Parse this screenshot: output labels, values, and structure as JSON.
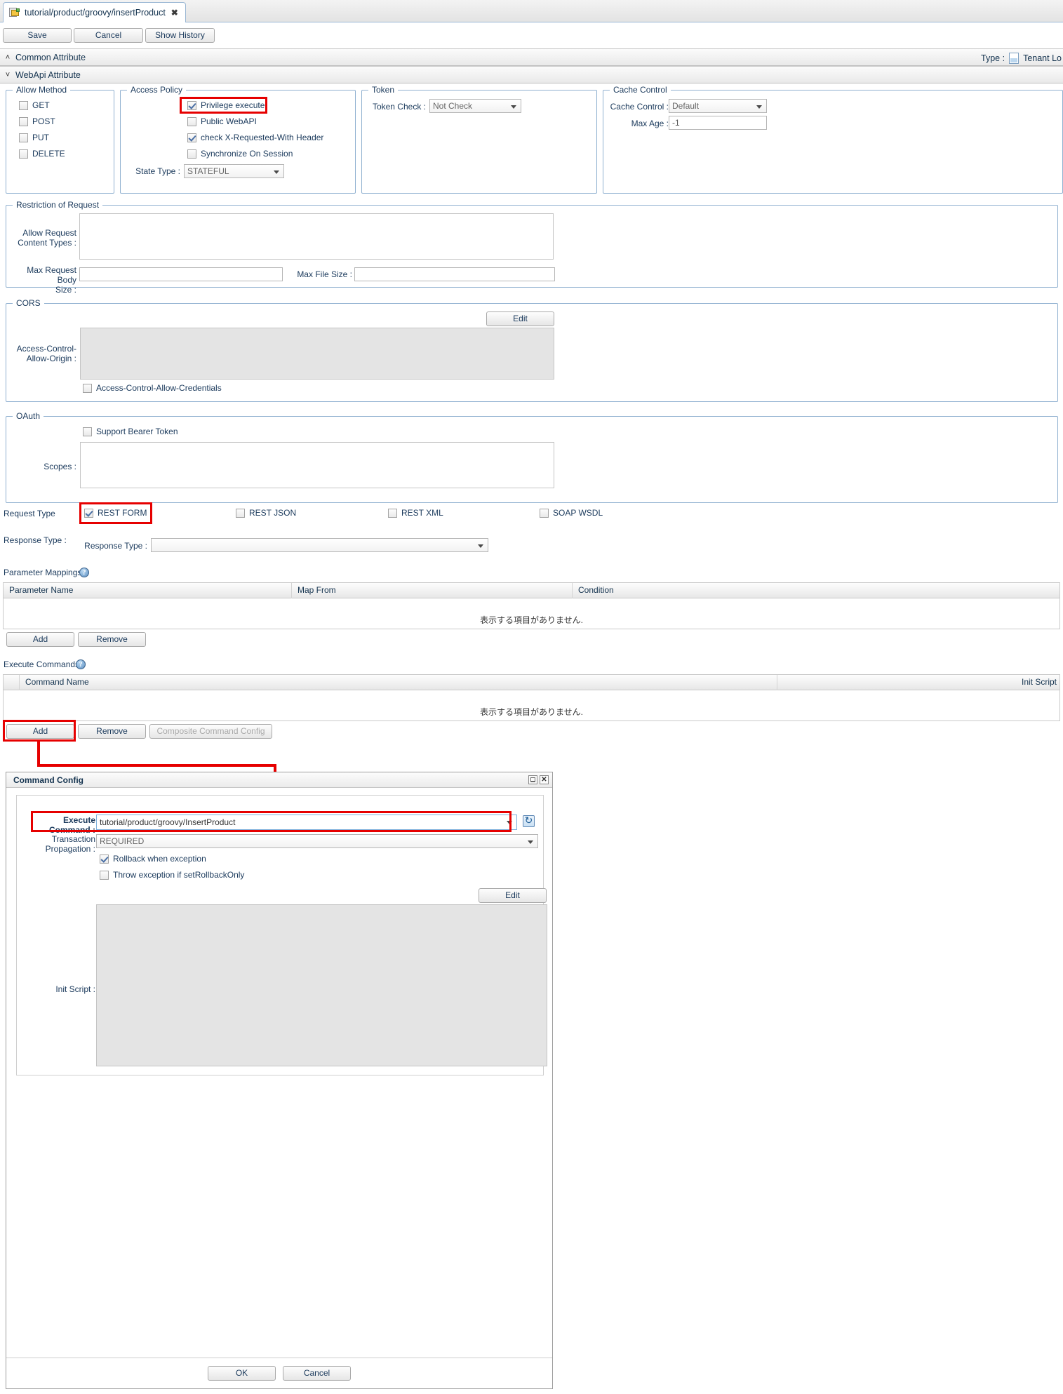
{
  "tab": {
    "title": "tutorial/product/groovy/insertProduct",
    "close": "✖",
    "icon": "script-file-icon"
  },
  "toolbar": {
    "save": "Save",
    "cancel": "Cancel",
    "show_history": "Show History"
  },
  "sections": {
    "common": {
      "label": "Common Attribute",
      "caret": "˄"
    },
    "webapi": {
      "label": "WebApi Attribute",
      "caret": "˅"
    },
    "type_label": "Type :",
    "type_value": "Tenant Lo"
  },
  "allow_method": {
    "legend": "Allow Method",
    "items": [
      {
        "label": "GET",
        "checked": false
      },
      {
        "label": "POST",
        "checked": false
      },
      {
        "label": "PUT",
        "checked": false
      },
      {
        "label": "DELETE",
        "checked": false
      }
    ]
  },
  "access_policy": {
    "legend": "Access Policy",
    "items": [
      {
        "label": "Privilege execute",
        "checked": true
      },
      {
        "label": "Public WebAPI",
        "checked": false
      },
      {
        "label": "check X-Requested-With Header",
        "checked": true
      },
      {
        "label": "Synchronize On Session",
        "checked": false
      }
    ],
    "state_type_label": "State Type :",
    "state_type_value": "STATEFUL"
  },
  "token": {
    "legend": "Token",
    "check_label": "Token Check :",
    "check_value": "Not Check"
  },
  "cache_control": {
    "legend": "Cache Control",
    "cache_label": "Cache Control :",
    "cache_value": "Default",
    "maxage_label": "Max Age :",
    "maxage_value": "-1"
  },
  "restriction": {
    "legend": "Restriction of Request",
    "content_types_label": "Allow Request\nContent Types :",
    "content_types_line1": "Allow Request",
    "content_types_line2": "Content Types :",
    "content_types_value": "",
    "max_body_line1": "Max Request Body",
    "max_body_line2": "Size :",
    "max_body_value": "",
    "max_file_label": "Max File Size :",
    "max_file_value": ""
  },
  "cors": {
    "legend": "CORS",
    "edit": "Edit",
    "origin_line1": "Access-Control-",
    "origin_line2": "Allow-Origin :",
    "origin_value": "",
    "credentials_label": "Access-Control-Allow-Credentials",
    "credentials_checked": false
  },
  "oauth": {
    "legend": "OAuth",
    "bearer_label": "Support Bearer Token",
    "bearer_checked": false,
    "scopes_label": "Scopes :",
    "scopes_value": ""
  },
  "request_type": {
    "label": "Request Type",
    "items": [
      {
        "label": "REST FORM",
        "checked": true
      },
      {
        "label": "REST JSON",
        "checked": false
      },
      {
        "label": "REST XML",
        "checked": false
      },
      {
        "label": "SOAP WSDL",
        "checked": false
      }
    ]
  },
  "response_type": {
    "outer_label": "Response Type :",
    "inner_label": "Response Type :",
    "value": ""
  },
  "parameter_mappings": {
    "label": "Parameter Mappings:",
    "help": "?",
    "columns": [
      "Parameter Name",
      "Map From",
      "Condition"
    ],
    "empty_text": "表示する項目がありません.",
    "add": "Add",
    "remove": "Remove"
  },
  "execute_commands": {
    "label": "Execute Commands:",
    "help": "?",
    "columns": [
      "Command Name",
      "Init Script"
    ],
    "empty_text": "表示する項目がありません.",
    "add": "Add",
    "remove": "Remove",
    "composite": "Composite Command Config"
  },
  "dialog": {
    "title": "Command Config",
    "minimize": "",
    "close": "✕",
    "execute_line1": "Execute",
    "execute_line2": "Command :",
    "execute_value": "tutorial/product/groovy/InsertProduct",
    "refresh_icon": "refresh-icon",
    "transaction_line1": "Transaction",
    "transaction_line2": "Propagation :",
    "transaction_value": "REQUIRED",
    "rollback_label": "Rollback when exception",
    "rollback_checked": true,
    "throw_label": "Throw exception if setRollbackOnly",
    "throw_checked": false,
    "edit": "Edit",
    "init_script_label": "Init Script :",
    "init_script_value": "",
    "ok": "OK",
    "cancel": "Cancel"
  },
  "colors": {
    "highlight": "#e60000",
    "label_blue": "#1b3a5c",
    "border_blue": "#8fb0d0"
  }
}
